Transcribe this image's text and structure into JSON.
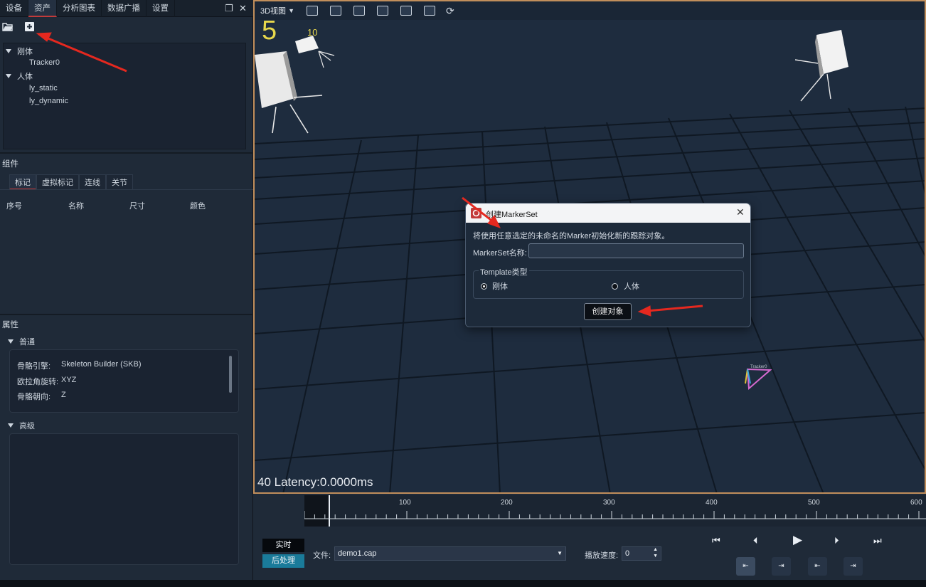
{
  "left_panel": {
    "tabs": [
      "设备",
      "资产",
      "分析图表",
      "数据广播",
      "设置"
    ],
    "active_tab": "资产",
    "assets": {
      "groups": [
        {
          "label": "刚体",
          "items": [
            "Tracker0"
          ]
        },
        {
          "label": "人体",
          "items": [
            "ly_static",
            "ly_dynamic"
          ]
        }
      ]
    },
    "components": {
      "title": "组件",
      "tabs": [
        "标记",
        "虚拟标记",
        "连线",
        "关节"
      ],
      "active_tab": "标记",
      "columns": [
        "序号",
        "名称",
        "尺寸",
        "颜色"
      ]
    },
    "properties": {
      "title": "属性",
      "general_label": "普通",
      "rows": [
        {
          "key": "骨骼引擎:",
          "value": "Skeleton Builder (SKB)"
        },
        {
          "key": "欧拉角旋转:",
          "value": "XYZ"
        },
        {
          "key": "骨骼朝向:",
          "value": "Z"
        }
      ],
      "advanced_label": "高级"
    }
  },
  "viewport": {
    "view_mode": "3D视图",
    "camera_labels": [
      "5",
      "10"
    ],
    "status_text": "40 Latency:0.0000ms",
    "tracker_label": "Tracker0"
  },
  "dialog": {
    "title": "创建MarkerSet",
    "description": "将使用任意选定的未命名的Marker初始化新的跟踪对象。",
    "name_label": "MarkerSet名称:",
    "name_value": "",
    "template_group_label": "Template类型",
    "options": [
      "刚体",
      "人体"
    ],
    "selected_option": "刚体",
    "create_button": "创建对象"
  },
  "bottom": {
    "timeline_ticks": [
      "100",
      "200",
      "300",
      "400",
      "500",
      "600"
    ],
    "mode_realtime": "实时",
    "mode_post": "后处理",
    "file_label": "文件:",
    "file_value": "demo1.cap",
    "speed_label": "播放速度:",
    "speed_value": "0"
  },
  "colors": {
    "accent_red": "#c23a3a",
    "viewport_border": "#c18e5b",
    "post_process_active": "#1a7b9a"
  }
}
